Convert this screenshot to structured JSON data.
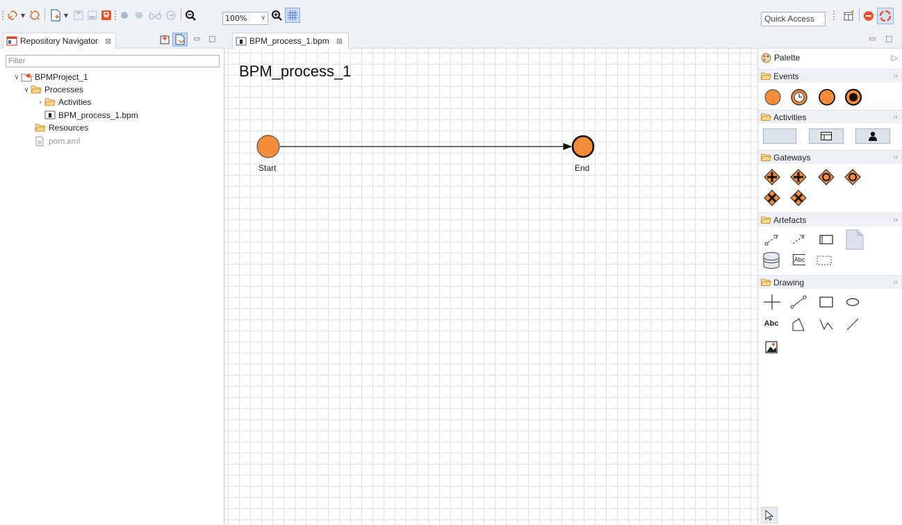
{
  "toolbar": {
    "zoom_value": "100%",
    "quick_access_placeholder": "Quick Access"
  },
  "navigator": {
    "tab_label": "Repository Navigator",
    "tab_close": "⊠",
    "filter_placeholder": "Filter",
    "tree": [
      {
        "label": "BPMProject_1",
        "level": 0,
        "expanded": true
      },
      {
        "label": "Processes",
        "level": 1,
        "expanded": true
      },
      {
        "label": "Activities",
        "level": 2,
        "expanded": false
      },
      {
        "label": "BPM_process_1.bpm",
        "level": 2
      },
      {
        "label": "Resources",
        "level": 1
      },
      {
        "label": "pom.xml",
        "level": 1
      }
    ]
  },
  "editor": {
    "tab_label": "BPM_process_1.bpm",
    "tab_close": "⊠",
    "diagram_title": "BPM_process_1",
    "start_label": "Start",
    "end_label": "End"
  },
  "palette": {
    "title": "Palette",
    "sections": [
      {
        "label": "Events"
      },
      {
        "label": "Activities"
      },
      {
        "label": "Gateways"
      },
      {
        "label": "Artefacts"
      },
      {
        "label": "Drawing"
      }
    ],
    "drawing_text_tool": "Abc",
    "artefact_text_tool": "Abc"
  },
  "colors": {
    "event_orange": "#f28c38",
    "event_stroke": "#1a1a1a",
    "accent_red": "#e8542a"
  }
}
